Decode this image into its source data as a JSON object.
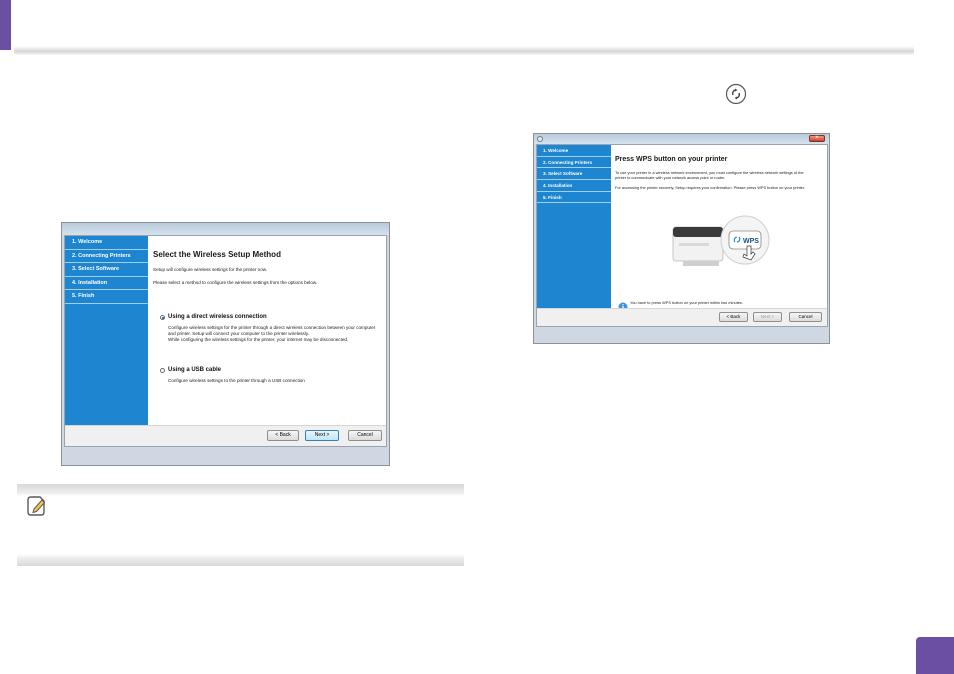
{
  "colors": {
    "accent": "#6b4fa2",
    "sidebar_blue": "#1e86d0"
  },
  "window1": {
    "steps": [
      "1. Welcome",
      "2. Connecting Printers",
      "3. Select Software",
      "4. Installation",
      "5. Finish"
    ],
    "title": "Select the Wireless Setup Method",
    "intro": "Setup will configure wireless settings for the printer now.",
    "instruction": "Please select a method to configure the wireless settings from the options below.",
    "option1": {
      "label": "Using a direct wireless connection",
      "desc1": "Configure wireless settings for the printer through a direct wireless connection between your computer",
      "desc2": "and printer. Setup will connect your computer to the printer wirelessly.",
      "desc3": "While configuring the wireless settings for the printer, your internet may be disconnected.",
      "selected": true
    },
    "option2": {
      "label": "Using a USB cable",
      "desc1": "Configure wireless settings to the printer through a USB connection",
      "selected": false
    },
    "buttons": {
      "back": "< Back",
      "next": "Next >",
      "cancel": "Cancel"
    }
  },
  "window2": {
    "steps": [
      "1. Welcome",
      "2. Connecting Printers",
      "3. Select Software",
      "4. Installation",
      "5. Finish"
    ],
    "title": "Press WPS button on your printer",
    "text1": "To use your printer in a wireless network environment, you must configure the wireless network settings of the",
    "text2": "printer to communicate with your network access point or router.",
    "text3": "For accessing the printer securely, Setup requires your confirmation. Please press WPS button on your printer.",
    "wps_label": "WPS",
    "info": "You have to press WPS button on your printer within two minutes.",
    "buttons": {
      "back": "< Back",
      "next": "Next >",
      "cancel": "Cancel"
    }
  },
  "icons": {
    "wps_top": "wps-button-icon",
    "note": "note-pencil-icon",
    "info": "info-icon",
    "app": "installer-app-icon",
    "close": "close-icon",
    "printer": "printer-illustration",
    "hand": "pointing-hand-icon"
  }
}
